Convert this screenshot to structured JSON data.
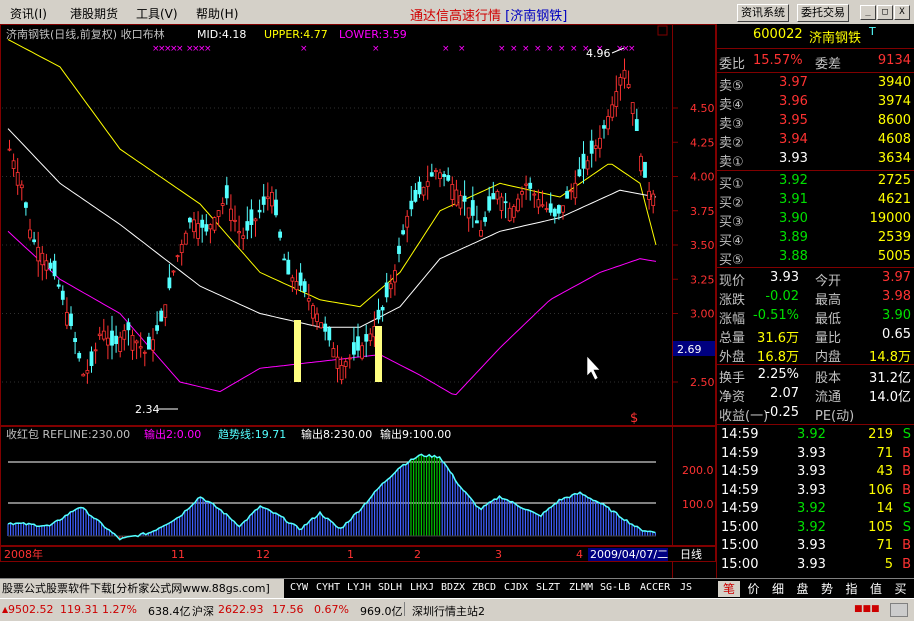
{
  "menu": {
    "items": [
      "资讯(I)",
      "港股期货",
      "工具(V)",
      "帮助(H)"
    ]
  },
  "window": {
    "title": "通达信高速行情",
    "stock_tag": "[济南钢铁]"
  },
  "top_buttons": [
    "资讯系统",
    "委托交易"
  ],
  "window_controls": [
    "_",
    "□",
    "X"
  ],
  "main_chart": {
    "header": "济南钢铁(日线,前复权) 收口布林",
    "mid_label": "MID:4.18",
    "upper_label": "UPPER:4.77",
    "lower_label": "LOWER:3.59",
    "price_labels": [
      "4.50",
      "4.25",
      "4.00",
      "3.75",
      "3.50",
      "3.25",
      "3.00",
      "2.75",
      "2.50"
    ],
    "high_annotation": "4.96",
    "low_annotation": "2.34",
    "current_price_box": "2.69",
    "s_marker": "$"
  },
  "sub_chart": {
    "header": "收红包 REFLINE:230.00",
    "out2_label": "输出2:0.00",
    "trend_label": "趋势线:19.71",
    "out8_label": "输出8:230.00",
    "out9_label": "输出9:100.00",
    "axis_labels": [
      "200.0",
      "100.0"
    ]
  },
  "date_axis": {
    "labels": [
      "2008年",
      "11",
      "12",
      "1",
      "2",
      "3",
      "4"
    ],
    "current_date": "2009/04/07/二",
    "period": "日线"
  },
  "chart_data": [
    {
      "type": "candlestick",
      "title": "济南钢铁(日线,前复权) 收口布林",
      "ylim": [
        2.3,
        5.0
      ],
      "series": [
        {
          "name": "MID",
          "last": 4.18
        },
        {
          "name": "UPPER",
          "last": 4.77
        },
        {
          "name": "LOWER",
          "last": 3.59
        }
      ],
      "annotations": {
        "high": 4.96,
        "low": 2.34
      },
      "x_ticks": [
        "2008年",
        "11",
        "12",
        "1",
        "2",
        "3",
        "4"
      ]
    },
    {
      "type": "area",
      "title": "收红包 REFLINE:230.00",
      "refline": 230.0,
      "second_line": 100.0,
      "y_ticks": [
        200.0,
        100.0
      ]
    }
  ],
  "quote": {
    "code": "600022",
    "name": "济南钢铁",
    "suffix": "T",
    "ratio_label": "委比",
    "ratio_value": "15.57%",
    "diff_label": "委差",
    "diff_value": "9134",
    "sells": [
      {
        "label": "卖⑤",
        "price": "3.97",
        "vol": "3940"
      },
      {
        "label": "卖④",
        "price": "3.96",
        "vol": "3974"
      },
      {
        "label": "卖③",
        "price": "3.95",
        "vol": "8600"
      },
      {
        "label": "卖②",
        "price": "3.94",
        "vol": "4608"
      },
      {
        "label": "卖①",
        "price": "3.93",
        "vol": "3634"
      }
    ],
    "buys": [
      {
        "label": "买①",
        "price": "3.92",
        "vol": "2725"
      },
      {
        "label": "买②",
        "price": "3.91",
        "vol": "4621"
      },
      {
        "label": "买③",
        "price": "3.90",
        "vol": "19000"
      },
      {
        "label": "买④",
        "price": "3.89",
        "vol": "2539"
      },
      {
        "label": "买⑤",
        "price": "3.88",
        "vol": "5005"
      }
    ],
    "stats": [
      {
        "l1": "现价",
        "v1": "3.93",
        "l2": "今开",
        "v2": "3.97"
      },
      {
        "l1": "涨跌",
        "v1": "-0.02",
        "l2": "最高",
        "v2": "3.98"
      },
      {
        "l1": "涨幅",
        "v1": "-0.51%",
        "l2": "最低",
        "v2": "3.90"
      },
      {
        "l1": "总量",
        "v1": "31.6万",
        "l2": "量比",
        "v2": "0.65"
      },
      {
        "l1": "外盘",
        "v1": "16.8万",
        "l2": "内盘",
        "v2": "14.8万"
      }
    ],
    "stats2": [
      {
        "l1": "换手",
        "v1": "2.25%",
        "l2": "股本",
        "v2": "31.2亿"
      },
      {
        "l1": "净资",
        "v1": "2.07",
        "l2": "流通",
        "v2": "14.0亿"
      },
      {
        "l1": "收益(一)",
        "v1": "-0.25",
        "l2": "PE(动)",
        "v2": ""
      }
    ],
    "ticks": [
      {
        "time": "14:59",
        "price": "3.92",
        "vol": "219",
        "side": "S"
      },
      {
        "time": "14:59",
        "price": "3.93",
        "vol": "71",
        "side": "B"
      },
      {
        "time": "14:59",
        "price": "3.93",
        "vol": "43",
        "side": "B"
      },
      {
        "time": "14:59",
        "price": "3.93",
        "vol": "106",
        "side": "B"
      },
      {
        "time": "14:59",
        "price": "3.92",
        "vol": "14",
        "side": "S"
      },
      {
        "time": "15:00",
        "price": "3.92",
        "vol": "105",
        "side": "S"
      },
      {
        "time": "15:00",
        "price": "3.93",
        "vol": "71",
        "side": "B"
      },
      {
        "time": "15:00",
        "price": "3.93",
        "vol": "5",
        "side": "B"
      }
    ]
  },
  "status": {
    "ad_text": "股票公式股票软件下载[分析家公式网www.88gs.com]",
    "indicator_tabs": [
      "CYW",
      "CYHT",
      "LYJH",
      "SDLH",
      "LHXJ",
      "BDZX",
      "ZBCD",
      "CJDX",
      "SLZT",
      "ZLMM",
      "SG-LB",
      "ACCER",
      "JS"
    ],
    "right_tabs": [
      "笔",
      "价",
      "细",
      "盘",
      "势",
      "指",
      "值",
      "买"
    ]
  },
  "bottom": {
    "sh_index": "9502.52",
    "sh_change": "119.31",
    "sh_pct": "1.27%",
    "sh_amount": "638.4亿",
    "sz_label": "沪深",
    "sz_index": "2622.93",
    "sz_change": "17.56",
    "sz_pct": "0.67%",
    "sz_amount": "969.0亿",
    "server": "深圳行情主站2"
  },
  "colors": {
    "up": "#ff3232",
    "down": "#54ffff",
    "mid": "#ffffff",
    "upper": "#ffff00",
    "lower": "#ff00ff",
    "frame": "#800000"
  }
}
